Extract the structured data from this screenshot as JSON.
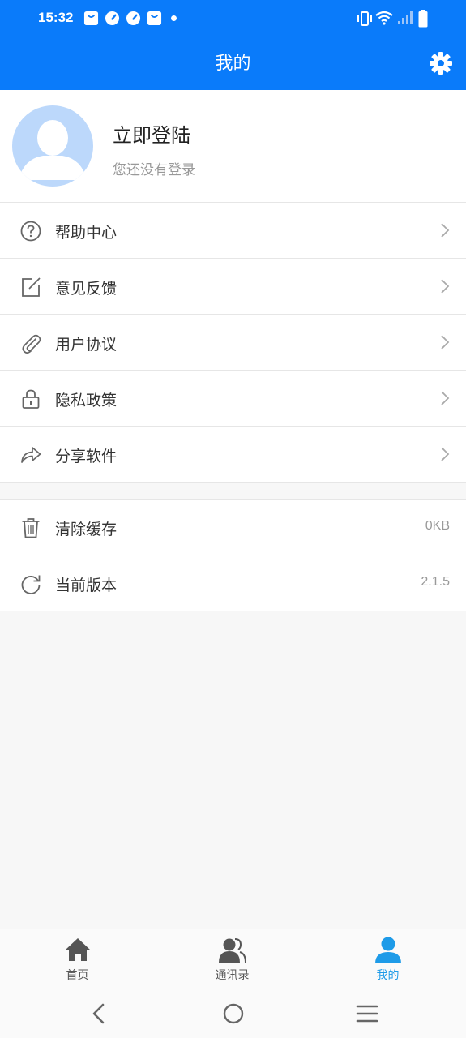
{
  "status_bar": {
    "time": "15:32",
    "icons": [
      "bag-notification-icon",
      "speedometer-icon",
      "speedometer-icon",
      "bag-notification-icon",
      "dot-icon",
      "vibrate-icon",
      "wifi-icon",
      "signal-icon",
      "battery-icon"
    ]
  },
  "header": {
    "title": "我的",
    "settings_icon": "gear-icon",
    "bg_color": "#0a7bfa"
  },
  "profile": {
    "login_text": "立即登陆",
    "sub_text": "您还没有登录",
    "avatar_icon": "default-avatar-icon"
  },
  "menu_primary": [
    {
      "label": "帮助中心",
      "icon": "help-circle-icon"
    },
    {
      "label": "意见反馈",
      "icon": "edit-note-icon"
    },
    {
      "label": "用户协议",
      "icon": "paperclip-icon"
    },
    {
      "label": "隐私政策",
      "icon": "lock-icon"
    },
    {
      "label": "分享软件",
      "icon": "share-arrow-icon"
    }
  ],
  "menu_secondary": [
    {
      "label": "清除缓存",
      "icon": "trash-icon",
      "value": "0KB"
    },
    {
      "label": "当前版本",
      "icon": "refresh-icon",
      "value": "2.1.5"
    }
  ],
  "bottom_nav": [
    {
      "label": "首页",
      "icon": "home-icon",
      "active": false
    },
    {
      "label": "通讯录",
      "icon": "contacts-icon",
      "active": false
    },
    {
      "label": "我的",
      "icon": "person-icon",
      "active": true
    }
  ],
  "colors": {
    "accent": "#0a7bfa",
    "active_tab": "#1e9be8",
    "avatar_bg": "#bcd8fb"
  }
}
